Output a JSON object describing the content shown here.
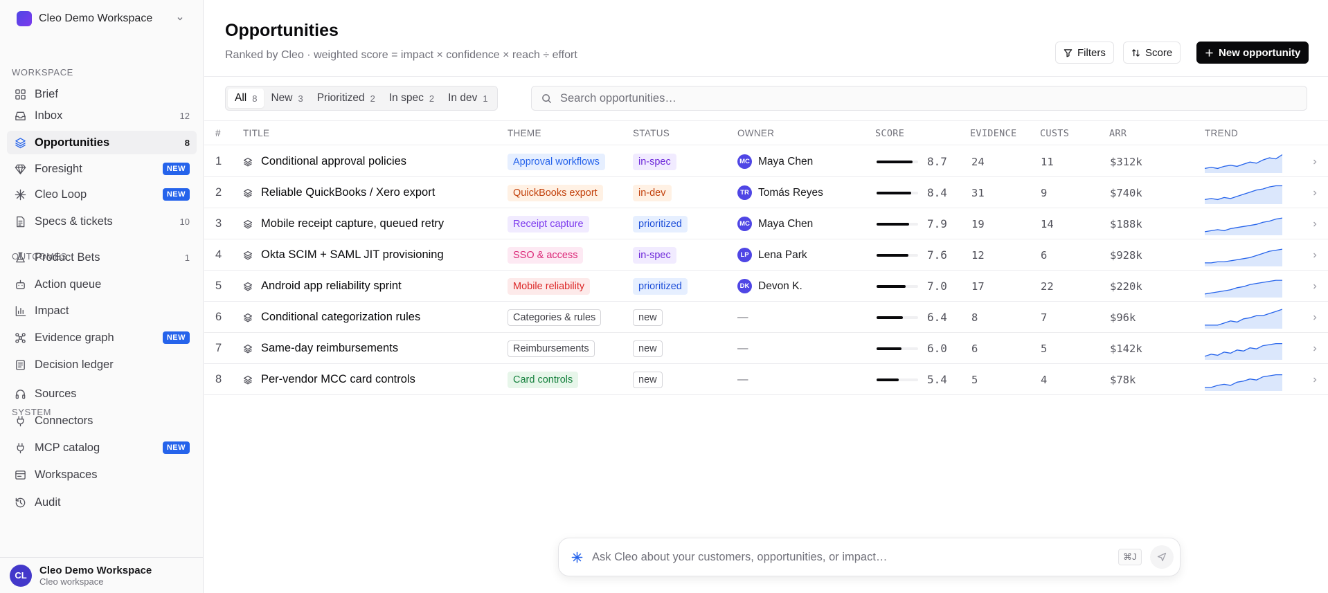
{
  "workspace": {
    "name": "Cleo Demo Workspace"
  },
  "sidebar": {
    "sections": [
      {
        "label": "WORKSPACE"
      },
      {
        "label": "OUTCOMES"
      },
      {
        "label": "SYSTEM"
      }
    ],
    "items": [
      {
        "label": "Brief",
        "icon": "grid-icon",
        "count": "",
        "badge": ""
      },
      {
        "label": "Inbox",
        "icon": "inbox-icon",
        "count": "12",
        "badge": ""
      },
      {
        "label": "Opportunities",
        "icon": "layers-icon",
        "count": "8",
        "badge": "",
        "active": true
      },
      {
        "label": "Foresight",
        "icon": "gem-icon",
        "count": "",
        "badge": "NEW"
      },
      {
        "label": "Cleo Loop",
        "icon": "sparkle-icon",
        "count": "",
        "badge": "NEW"
      },
      {
        "label": "Specs & tickets",
        "icon": "document-icon",
        "count": "10",
        "badge": ""
      },
      {
        "label": "Product Bets",
        "icon": "flask-icon",
        "count": "1",
        "badge": ""
      },
      {
        "label": "Action queue",
        "icon": "bot-icon",
        "count": "",
        "badge": ""
      },
      {
        "label": "Impact",
        "icon": "bar-chart-icon",
        "count": "",
        "badge": ""
      },
      {
        "label": "Evidence graph",
        "icon": "graph-icon",
        "count": "",
        "badge": "NEW"
      },
      {
        "label": "Decision ledger",
        "icon": "ledger-icon",
        "count": "",
        "badge": ""
      },
      {
        "label": "Sources",
        "icon": "headset-icon",
        "count": "",
        "badge": ""
      },
      {
        "label": "Connectors",
        "icon": "plug-icon",
        "count": "",
        "badge": ""
      },
      {
        "label": "MCP catalog",
        "icon": "plug-icon",
        "count": "",
        "badge": "NEW"
      },
      {
        "label": "Workspaces",
        "icon": "browser-icon",
        "count": "",
        "badge": ""
      },
      {
        "label": "Audit",
        "icon": "history-icon",
        "count": "",
        "badge": ""
      }
    ]
  },
  "user": {
    "initials": "CL",
    "name": "Cleo Demo Workspace",
    "sub": "Cleo workspace"
  },
  "header": {
    "title": "Opportunities",
    "subtitle": "Ranked by Cleo · weighted score = impact × confidence × reach ÷ effort",
    "filters_label": "Filters",
    "score_label": "Score",
    "new_label": "New opportunity"
  },
  "tabs": [
    {
      "label": "All",
      "count": "8"
    },
    {
      "label": "New",
      "count": "3"
    },
    {
      "label": "Prioritized",
      "count": "2"
    },
    {
      "label": "In spec",
      "count": "2"
    },
    {
      "label": "In dev",
      "count": "1"
    }
  ],
  "search": {
    "placeholder": "Search opportunities…"
  },
  "table": {
    "columns": [
      "#",
      "TITLE",
      "THEME",
      "STATUS",
      "OWNER",
      "SCORE",
      "EVIDENCE",
      "CUSTS",
      "ARR",
      "TREND"
    ],
    "rows": [
      {
        "num": "1",
        "title": "Conditional approval policies",
        "theme": "Approval workflows",
        "theme_color": "#2563eb",
        "theme_bg": "#e6efff",
        "status": "in-spec",
        "owner_initials": "MC",
        "owner": "Maya Chen",
        "score": 8.7,
        "evidence": "24",
        "custs": "11",
        "arr": "$312k",
        "trend": [
          3,
          4,
          3,
          5,
          6,
          5,
          7,
          9,
          8,
          11,
          13,
          12,
          16
        ]
      },
      {
        "num": "2",
        "title": "Reliable QuickBooks / Xero export",
        "theme": "QuickBooks export",
        "theme_color": "#c2410c",
        "theme_bg": "#fff1e4",
        "status": "in-dev",
        "owner_initials": "TR",
        "owner": "Tomás Reyes",
        "score": 8.4,
        "evidence": "31",
        "custs": "9",
        "arr": "$740k",
        "trend": [
          3,
          4,
          3,
          5,
          4,
          6,
          8,
          10,
          12,
          13,
          15,
          16,
          16
        ]
      },
      {
        "num": "3",
        "title": "Mobile receipt capture, queued retry",
        "theme": "Receipt capture",
        "theme_color": "#7c3aed",
        "theme_bg": "#f1ebff",
        "status": "prioritized",
        "owner_initials": "MC",
        "owner": "Maya Chen",
        "score": 7.9,
        "evidence": "19",
        "custs": "14",
        "arr": "$188k",
        "trend": [
          2,
          3,
          4,
          3,
          5,
          6,
          7,
          8,
          9,
          11,
          12,
          14,
          15
        ]
      },
      {
        "num": "4",
        "title": "Okta SCIM + SAML JIT provisioning",
        "theme": "SSO & access",
        "theme_color": "#db2777",
        "theme_bg": "#fde9f3",
        "status": "in-spec",
        "owner_initials": "LP",
        "owner": "Lena Park",
        "score": 7.6,
        "evidence": "12",
        "custs": "6",
        "arr": "$928k",
        "trend": [
          2,
          2,
          3,
          3,
          4,
          5,
          6,
          7,
          9,
          11,
          13,
          14,
          15
        ]
      },
      {
        "num": "5",
        "title": "Android app reliability sprint",
        "theme": "Mobile reliability",
        "theme_color": "#dc2626",
        "theme_bg": "#fdeaea",
        "status": "prioritized",
        "owner_initials": "DK",
        "owner": "Devon K.",
        "score": 7.0,
        "evidence": "17",
        "custs": "22",
        "arr": "$220k",
        "trend": [
          2,
          3,
          4,
          5,
          6,
          8,
          9,
          11,
          12,
          13,
          14,
          15,
          15
        ]
      },
      {
        "num": "6",
        "title": "Conditional categorization rules",
        "theme": "Categories & rules",
        "theme_color": "#3f3f46",
        "theme_bg": "#ffffff",
        "status": "new",
        "owner_initials": "",
        "owner": "—",
        "score": 6.4,
        "evidence": "8",
        "custs": "7",
        "arr": "$96k",
        "trend": [
          2,
          2,
          2,
          4,
          6,
          5,
          8,
          9,
          11,
          11,
          13,
          15,
          17
        ]
      },
      {
        "num": "7",
        "title": "Same-day reimbursements",
        "theme": "Reimbursements",
        "theme_color": "#3f3f46",
        "theme_bg": "#ffffff",
        "status": "new",
        "owner_initials": "",
        "owner": "—",
        "score": 6.0,
        "evidence": "6",
        "custs": "5",
        "arr": "$142k",
        "trend": [
          2,
          4,
          3,
          6,
          5,
          8,
          7,
          10,
          9,
          12,
          13,
          14,
          14
        ]
      },
      {
        "num": "8",
        "title": "Per-vendor MCC card controls",
        "theme": "Card controls",
        "theme_color": "#15803d",
        "theme_bg": "#e7f6ea",
        "status": "new",
        "owner_initials": "",
        "owner": "—",
        "score": 5.4,
        "evidence": "5",
        "custs": "4",
        "arr": "$78k",
        "trend": [
          2,
          2,
          4,
          5,
          4,
          7,
          8,
          10,
          9,
          12,
          13,
          14,
          14
        ]
      }
    ]
  },
  "ask": {
    "placeholder": "Ask Cleo about your customers, opportunities, or impact…",
    "shortcut": "⌘J"
  },
  "colors": {
    "accent": "#2563eb",
    "primary_button": "#09090b",
    "trend_line": "#2563eb",
    "trend_fill": "#dbe7fc"
  }
}
